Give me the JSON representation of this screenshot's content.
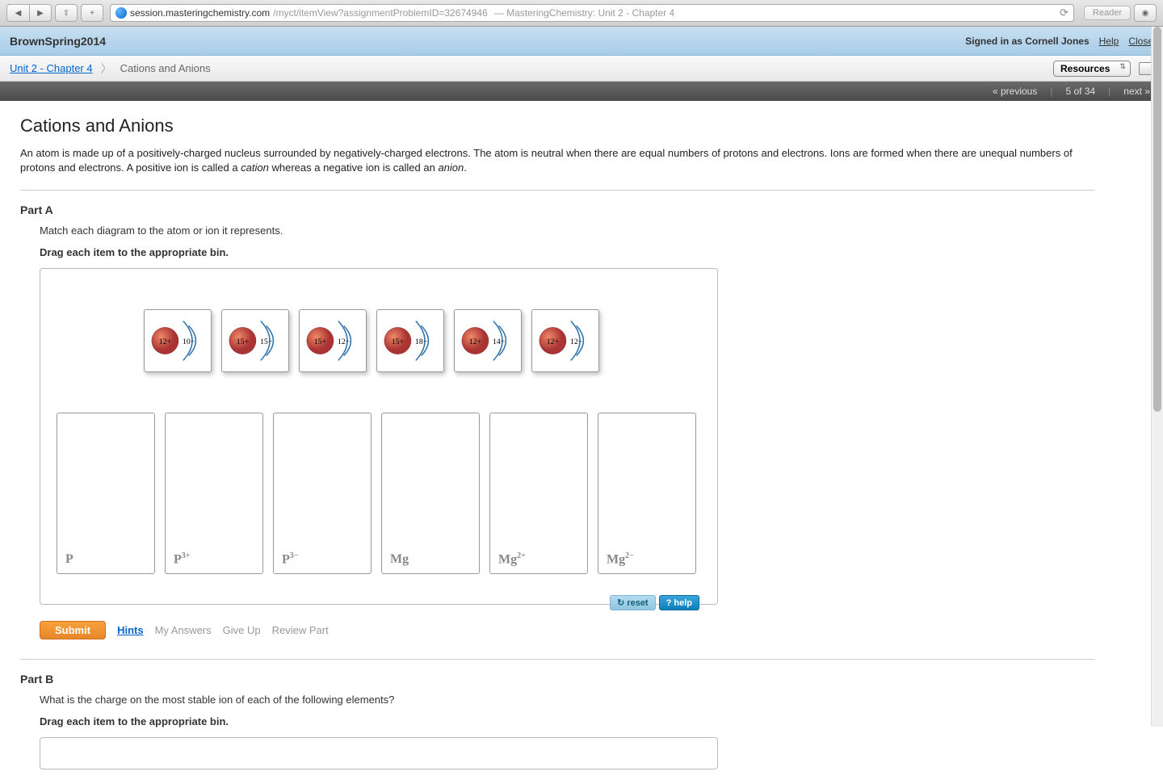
{
  "browser": {
    "url_host": "session.masteringchemistry.com",
    "url_path": "/myct/itemView?assignmentProblemID=32674946",
    "url_sep": " — ",
    "page_title": "MasteringChemistry: Unit 2 - Chapter 4",
    "reader_label": "Reader"
  },
  "course": {
    "name": "BrownSpring2014",
    "signed_in_prefix": "Signed in as ",
    "user": "Cornell Jones",
    "help": "Help",
    "close": "Close"
  },
  "breadcrumb": {
    "parent": "Unit 2 - Chapter 4",
    "current": "Cations and Anions",
    "resources_label": "Resources"
  },
  "navstrip": {
    "prev": "« previous",
    "counter": "5 of 34",
    "next": "next »"
  },
  "page": {
    "title": "Cations and Anions",
    "intro_a": "An atom is made up of a positively-charged nucleus surrounded by negatively-charged electrons. The atom is neutral when there are equal numbers of protons and electrons. Ions are formed when there are unequal numbers of protons and electrons. A positive ion is called a ",
    "intro_em1": "cation",
    "intro_b": " whereas a negative ion is called an ",
    "intro_em2": "anion",
    "intro_c": "."
  },
  "partA": {
    "label": "Part A",
    "instr": "Match each diagram to the atom or ion it represents.",
    "drag_instr": "Drag each item to the appropriate bin.",
    "tiles": [
      {
        "p": "12+",
        "e": "10−"
      },
      {
        "p": "15+",
        "e": "15−"
      },
      {
        "p": "15+",
        "e": "12−"
      },
      {
        "p": "15+",
        "e": "18−"
      },
      {
        "p": "12+",
        "e": "14−"
      },
      {
        "p": "12+",
        "e": "12−"
      }
    ],
    "bins": [
      {
        "label": "P",
        "sup": ""
      },
      {
        "label": "P",
        "sup": "3+"
      },
      {
        "label": "P",
        "sup": "3−"
      },
      {
        "label": "Mg",
        "sup": ""
      },
      {
        "label": "Mg",
        "sup": "2+"
      },
      {
        "label": "Mg",
        "sup": "2−"
      }
    ],
    "reset": "reset",
    "help": "help"
  },
  "controls": {
    "submit": "Submit",
    "hints": "Hints",
    "my_answers": "My Answers",
    "give_up": "Give Up",
    "review": "Review Part"
  },
  "partB": {
    "label": "Part B",
    "instr": "What is the charge on the most stable ion of each of the following elements?",
    "drag_instr": "Drag each item to the appropriate bin."
  }
}
